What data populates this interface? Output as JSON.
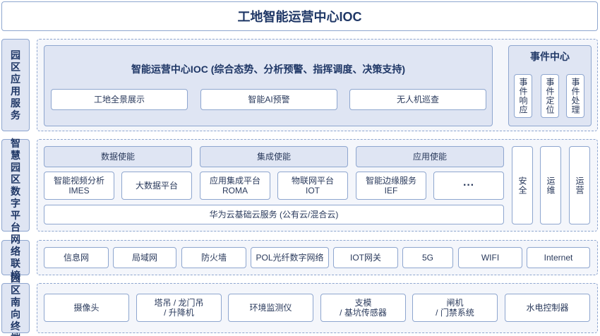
{
  "title": "工地智能运营中心IOC",
  "layers": {
    "app": {
      "label": "园区应用服务",
      "ioc_title": "智能运营中心IOC (综合态势、分析预警、指挥调度、决策支持)",
      "ioc_items": [
        "工地全景展示",
        "智能AI预警",
        "无人机巡查"
      ],
      "event_title": "事件中心",
      "event_items": [
        "事件响应",
        "事件定位",
        "事件处理"
      ]
    },
    "platform": {
      "label": "智慧园区数字平台",
      "enablers": [
        "数据使能",
        "集成使能",
        "应用使能"
      ],
      "services": [
        {
          "line1": "智能视频分析",
          "line2": "IMES"
        },
        {
          "line1": "大数据平台",
          "line2": ""
        },
        {
          "line1": "应用集成平台",
          "line2": "ROMA"
        },
        {
          "line1": "物联网平台",
          "line2": "IOT"
        },
        {
          "line1": "智能边缘服务",
          "line2": "IEF"
        },
        {
          "line1": "···",
          "line2": ""
        }
      ],
      "cloud": "华为云基础云服务 (公有云/混合云)",
      "side": [
        "安全",
        "运维",
        "运营"
      ]
    },
    "network": {
      "label": "网络联接",
      "items": [
        "信息网",
        "局域网",
        "防火墙",
        "POL光纤数字网络",
        "IOT网关",
        "5G",
        "WIFI",
        "Internet"
      ]
    },
    "terminal": {
      "label": "园区南向终端",
      "items": [
        {
          "line1": "摄像头",
          "line2": ""
        },
        {
          "line1": "塔吊 / 龙门吊",
          "line2": "/ 升降机"
        },
        {
          "line1": "环境监测仪",
          "line2": ""
        },
        {
          "line1": "支模",
          "line2": "/ 基坑传感器"
        },
        {
          "line1": "闸机",
          "line2": "/ 门禁系统"
        },
        {
          "line1": "水电控制器",
          "line2": ""
        }
      ]
    }
  }
}
